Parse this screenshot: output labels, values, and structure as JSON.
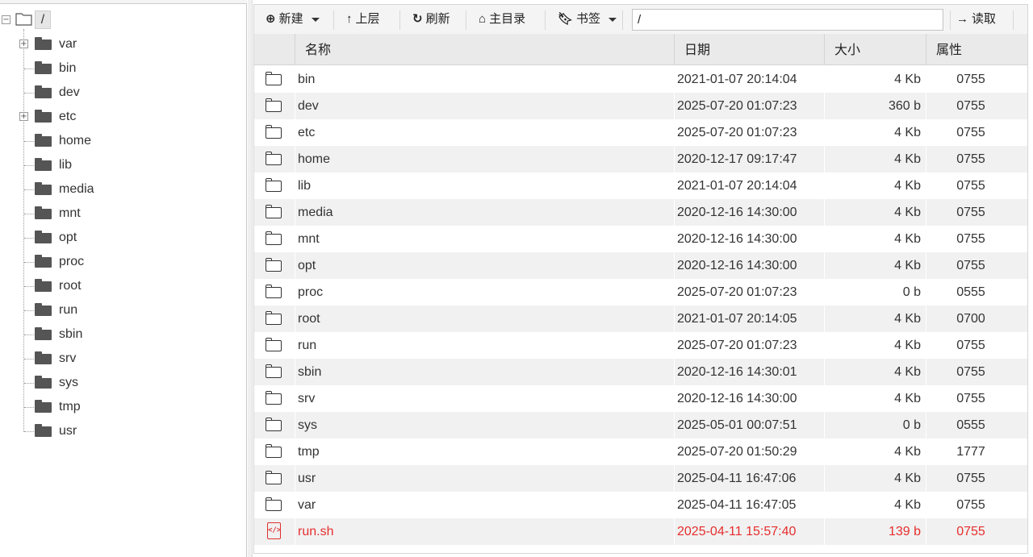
{
  "tree": {
    "root_label": "/",
    "items": [
      {
        "label": "var",
        "expandable": true
      },
      {
        "label": "bin",
        "expandable": false
      },
      {
        "label": "dev",
        "expandable": false
      },
      {
        "label": "etc",
        "expandable": true
      },
      {
        "label": "home",
        "expandable": false
      },
      {
        "label": "lib",
        "expandable": false
      },
      {
        "label": "media",
        "expandable": false
      },
      {
        "label": "mnt",
        "expandable": false
      },
      {
        "label": "opt",
        "expandable": false
      },
      {
        "label": "proc",
        "expandable": false
      },
      {
        "label": "root",
        "expandable": false
      },
      {
        "label": "run",
        "expandable": false
      },
      {
        "label": "sbin",
        "expandable": false
      },
      {
        "label": "srv",
        "expandable": false
      },
      {
        "label": "sys",
        "expandable": false
      },
      {
        "label": "tmp",
        "expandable": false
      },
      {
        "label": "usr",
        "expandable": false
      }
    ]
  },
  "toolbar": {
    "new_label": "新建",
    "up_label": "上层",
    "refresh_label": "刷新",
    "home_label": "主目录",
    "bookmark_label": "书签",
    "path_value": "/",
    "read_label": "读取"
  },
  "columns": {
    "name": "名称",
    "date": "日期",
    "size": "大小",
    "attr": "属性"
  },
  "rows": [
    {
      "type": "folder",
      "name": "bin",
      "date": "2021-01-07 20:14:04",
      "size": "4 Kb",
      "attr": "0755"
    },
    {
      "type": "folder",
      "name": "dev",
      "date": "2025-07-20 01:07:23",
      "size": "360 b",
      "attr": "0755"
    },
    {
      "type": "folder",
      "name": "etc",
      "date": "2025-07-20 01:07:23",
      "size": "4 Kb",
      "attr": "0755"
    },
    {
      "type": "folder",
      "name": "home",
      "date": "2020-12-17 09:17:47",
      "size": "4 Kb",
      "attr": "0755"
    },
    {
      "type": "folder",
      "name": "lib",
      "date": "2021-01-07 20:14:04",
      "size": "4 Kb",
      "attr": "0755"
    },
    {
      "type": "folder",
      "name": "media",
      "date": "2020-12-16 14:30:00",
      "size": "4 Kb",
      "attr": "0755"
    },
    {
      "type": "folder",
      "name": "mnt",
      "date": "2020-12-16 14:30:00",
      "size": "4 Kb",
      "attr": "0755"
    },
    {
      "type": "folder",
      "name": "opt",
      "date": "2020-12-16 14:30:00",
      "size": "4 Kb",
      "attr": "0755"
    },
    {
      "type": "folder",
      "name": "proc",
      "date": "2025-07-20 01:07:23",
      "size": "0 b",
      "attr": "0555"
    },
    {
      "type": "folder",
      "name": "root",
      "date": "2021-01-07 20:14:05",
      "size": "4 Kb",
      "attr": "0700"
    },
    {
      "type": "folder",
      "name": "run",
      "date": "2025-07-20 01:07:23",
      "size": "4 Kb",
      "attr": "0755"
    },
    {
      "type": "folder",
      "name": "sbin",
      "date": "2020-12-16 14:30:01",
      "size": "4 Kb",
      "attr": "0755"
    },
    {
      "type": "folder",
      "name": "srv",
      "date": "2020-12-16 14:30:00",
      "size": "4 Kb",
      "attr": "0755"
    },
    {
      "type": "folder",
      "name": "sys",
      "date": "2025-05-01 00:07:51",
      "size": "0 b",
      "attr": "0555"
    },
    {
      "type": "folder",
      "name": "tmp",
      "date": "2025-07-20 01:50:29",
      "size": "4 Kb",
      "attr": "1777"
    },
    {
      "type": "folder",
      "name": "usr",
      "date": "2025-04-11 16:47:06",
      "size": "4 Kb",
      "attr": "0755"
    },
    {
      "type": "folder",
      "name": "var",
      "date": "2025-04-11 16:47:05",
      "size": "4 Kb",
      "attr": "0755"
    },
    {
      "type": "file",
      "name": "run.sh",
      "date": "2025-04-11 15:57:40",
      "size": "139 b",
      "attr": "0755"
    }
  ],
  "colors": {
    "file_highlight": "#e62e2e",
    "row_alt": "#f1f1f1",
    "header_bg": "#eaeaea"
  },
  "icons": {
    "new": "plus-circle-icon",
    "up": "arrow-up-icon",
    "refresh": "refresh-icon",
    "home": "home-icon",
    "bookmark": "bookmark-icon",
    "read": "arrow-right-icon",
    "folder": "folder-icon",
    "script_file": "code-file-icon"
  }
}
